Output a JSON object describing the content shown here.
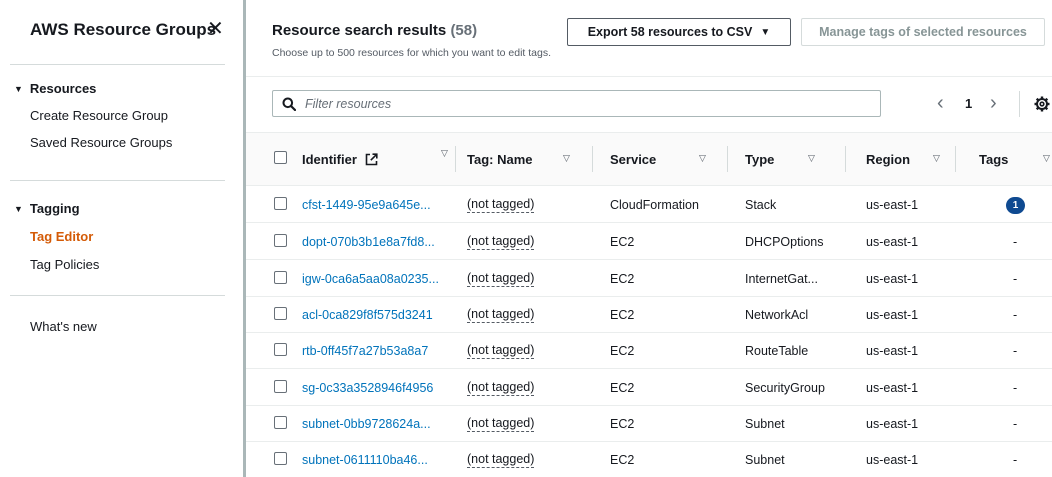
{
  "sidebar": {
    "title": "AWS Resource Groups",
    "close_glyph": "✕",
    "sections": [
      {
        "label": "Resources",
        "caret": "▼"
      },
      {
        "label": "Tagging",
        "caret": "▼"
      }
    ],
    "resources_links": [
      "Create Resource Group",
      "Saved Resource Groups"
    ],
    "tagging_links": [
      "Tag Editor",
      "Tag Policies"
    ],
    "whats_new": "What's new"
  },
  "header": {
    "title": "Resource search results",
    "count": "(58)",
    "subtitle": "Choose up to 500 resources for which you want to edit tags.",
    "export_label": "Export 58 resources to CSV",
    "export_caret": "▼",
    "manage_label": "Manage tags of selected resources"
  },
  "filter": {
    "placeholder": "Filter resources"
  },
  "pagination": {
    "prev": "‹",
    "page": "1",
    "next": "›"
  },
  "table": {
    "columns": [
      "Identifier",
      "Tag: Name",
      "Service",
      "Type",
      "Region",
      "Tags"
    ],
    "sort_glyph": "▽",
    "rows": [
      {
        "identifier": "cfst-1449-95e9a645e...",
        "tag_name": "(not tagged)",
        "service": "CloudFormation",
        "type": "Stack",
        "region": "us-east-1",
        "tags": "1"
      },
      {
        "identifier": "dopt-070b3b1e8a7fd8...",
        "tag_name": "(not tagged)",
        "service": "EC2",
        "type": "DHCPOptions",
        "region": "us-east-1",
        "tags": "-"
      },
      {
        "identifier": "igw-0ca6a5aa08a0235...",
        "tag_name": "(not tagged)",
        "service": "EC2",
        "type": "InternetGat...",
        "region": "us-east-1",
        "tags": "-"
      },
      {
        "identifier": "acl-0ca829f8f575d3241",
        "tag_name": "(not tagged)",
        "service": "EC2",
        "type": "NetworkAcl",
        "region": "us-east-1",
        "tags": "-"
      },
      {
        "identifier": "rtb-0ff45f7a27b53a8a7",
        "tag_name": "(not tagged)",
        "service": "EC2",
        "type": "RouteTable",
        "region": "us-east-1",
        "tags": "-"
      },
      {
        "identifier": "sg-0c33a3528946f4956",
        "tag_name": "(not tagged)",
        "service": "EC2",
        "type": "SecurityGroup",
        "region": "us-east-1",
        "tags": "-"
      },
      {
        "identifier": "subnet-0bb9728624a...",
        "tag_name": "(not tagged)",
        "service": "EC2",
        "type": "Subnet",
        "region": "us-east-1",
        "tags": "-"
      },
      {
        "identifier": "subnet-0611110ba46...",
        "tag_name": "(not tagged)",
        "service": "EC2",
        "type": "Subnet",
        "region": "us-east-1",
        "tags": "-"
      }
    ]
  },
  "colors": {
    "active_nav": "#d45b07",
    "link": "#0073bb",
    "badge": "#0f4a91",
    "muted_count": "#687078"
  },
  "icons": [
    "close-icon",
    "caret-down-icon",
    "search-icon",
    "external-link-icon",
    "settings-gear-icon",
    "chevron-left-icon",
    "chevron-right-icon",
    "sort-icon"
  ]
}
